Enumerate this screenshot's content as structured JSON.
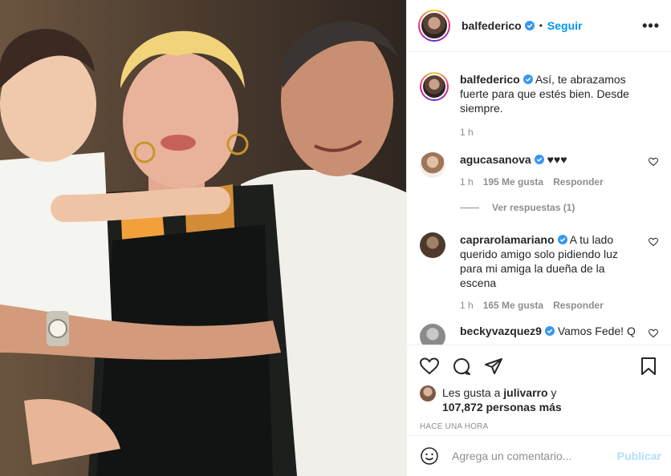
{
  "header": {
    "username": "balfederico",
    "follow_label": "Seguir",
    "separator": "•",
    "more_label": "•••"
  },
  "caption": {
    "username": "balfederico",
    "text": "Así, te abrazamos fuerte para que estés bien. Desde siempre.",
    "time": "1 h"
  },
  "comments": [
    {
      "username": "agucasanova",
      "text": "♥♥♥",
      "time": "1 h",
      "likes": "195 Me gusta",
      "reply_label": "Responder"
    },
    {
      "username": "caprarolamariano",
      "text": "A tu lado querido amigo solo pidiendo luz para mi amiga la dueña de la escena",
      "time": "1 h",
      "likes": "165 Me gusta",
      "reply_label": "Responder"
    },
    {
      "username": "beckyvazquez9",
      "text": "Vamos Fede! Q"
    }
  ],
  "view_replies": "Ver respuestas (1)",
  "likes": {
    "prefix": "Les gusta a ",
    "first_user": "julivarro",
    "middle": " y ",
    "count": "107,872 personas más"
  },
  "post_time": "HACE UNA HORA",
  "add_comment": {
    "placeholder": "Agrega un comentario...",
    "post_label": "Publicar"
  },
  "colors": {
    "link_blue": "#0095f6",
    "post_disabled": "#b2dffc",
    "secondary_text": "#8e8e8e",
    "verified_blue": "#3897f0"
  },
  "icons": [
    "verified-badge-icon",
    "heart-icon",
    "comment-icon",
    "share-icon",
    "bookmark-icon",
    "emoji-icon"
  ]
}
